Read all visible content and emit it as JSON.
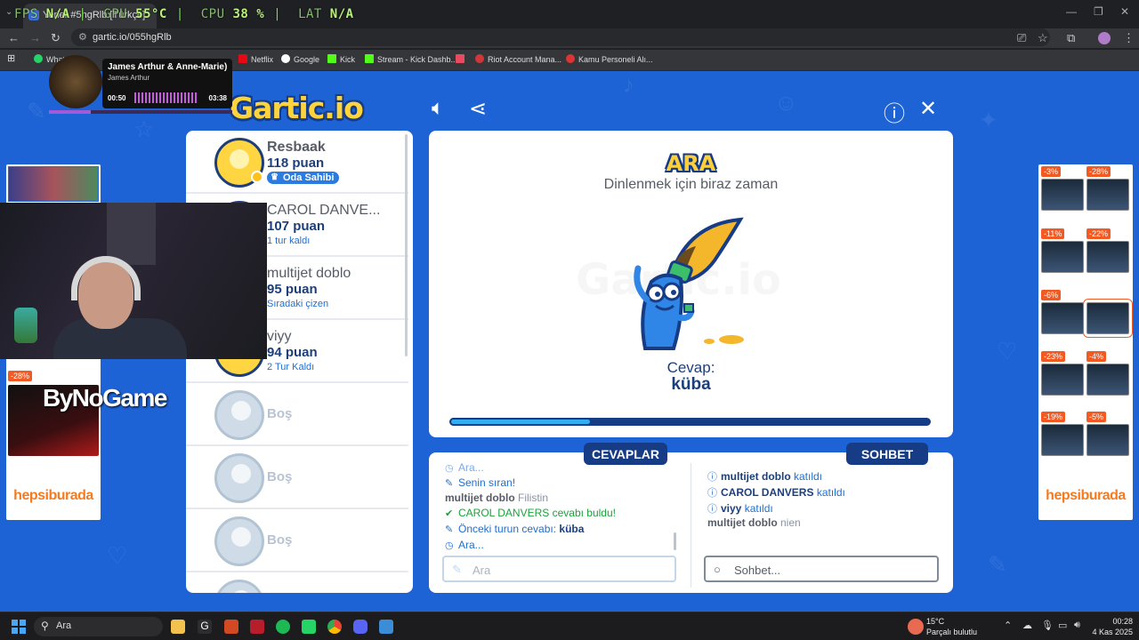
{
  "browser": {
    "tab_title": "Yerler #5hgRlb [Türkçe]",
    "url": "gartic.io/055hgRlb",
    "bookmarks": [
      "WhatsApp",
      "Netflix",
      "Google",
      "Kick",
      "Stream - Kick Dashb...",
      "Riot Account Mana...",
      "Kamu Personeli Alı..."
    ]
  },
  "perf_overlay": {
    "fps_label": "FPS",
    "fps_value": "N/A",
    "gpu_label": "GPU",
    "gpu_value": "55°C",
    "cpu_label": "CPU",
    "cpu_value": "38 %",
    "lat_label": "LAT",
    "lat_value": "N/A"
  },
  "music": {
    "title": "James Arthur & Anne-Marie)",
    "artist": "James Arthur",
    "elapsed": "00:50",
    "total": "03:38",
    "progress": 0.23
  },
  "game": {
    "logo": "Gartic.io",
    "players": [
      {
        "name": "Resbaak",
        "points": "118 puan",
        "badge": "Oda Sahibi"
      },
      {
        "name": "CAROL DANVE...",
        "points": "107 puan",
        "status": "1 tur kaldı"
      },
      {
        "name": "multijet doblo",
        "points": "95 puan",
        "status": "Sıradaki çizen"
      },
      {
        "name": "viyy",
        "points": "94 puan",
        "status": "2 Tur Kaldı"
      }
    ],
    "empty_slot_label": "Boş",
    "board": {
      "title": "ARA",
      "subtitle": "Dinlenmek için biraz zaman",
      "answer_label": "Cevap:",
      "answer_word": "küba",
      "progress": 0.29
    },
    "answers": {
      "header": "CEVAPLAR",
      "messages": [
        {
          "icon": "clock-icon",
          "text": "Ara..."
        },
        {
          "icon": "pencil-icon",
          "text": "Senin sıran!"
        },
        {
          "name": "multijet doblo",
          "text": "Filistin"
        },
        {
          "icon": "check-icon",
          "name": "CAROL DANVERS",
          "text": "cevabı buldu!"
        },
        {
          "icon": "pencil-icon",
          "text": "Önceki turun cevabı:",
          "value": "küba"
        },
        {
          "icon": "clock-icon",
          "text": "Ara..."
        }
      ],
      "input_placeholder": "Ara"
    },
    "chat": {
      "header": "SOHBET",
      "messages": [
        {
          "name": "multijet doblo",
          "text": "katıldı"
        },
        {
          "name": "CAROL DANVERS",
          "text": "katıldı"
        },
        {
          "name": "viyy",
          "text": "katıldı"
        },
        {
          "name": "multijet doblo",
          "text": "nien"
        }
      ],
      "input_placeholder": "Sohbet..."
    }
  },
  "ads": {
    "brand": "hepsiburada",
    "left_discount": "-28%",
    "right_discounts": [
      "-3%",
      "-28%",
      "-11%",
      "-22%",
      "-6%",
      "-23%",
      "-4%",
      "-19%",
      "-5%"
    ]
  },
  "stream_overlay": {
    "sponsor": "ByNoGame"
  },
  "taskbar": {
    "search_placeholder": "Ara",
    "temperature": "15°C",
    "weather": "Parçalı bulutlu",
    "time": "00:28",
    "date": "4 Kas 2025"
  },
  "colors": {
    "page_bg": "#1e63d6",
    "navy": "#173c86",
    "accent_yellow": "#ffd33b",
    "link_blue": "#1f6fd0",
    "success_green": "#1aa33a"
  }
}
